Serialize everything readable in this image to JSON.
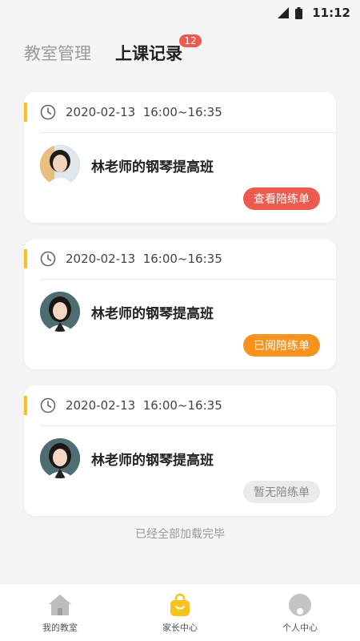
{
  "status_bar": {
    "time": "11:12"
  },
  "tabs": [
    {
      "label": "教室管理",
      "active": false
    },
    {
      "label": "上课记录",
      "active": true,
      "badge": "12"
    }
  ],
  "cards": [
    {
      "time": "2020-02-13  16:00~16:35",
      "title": "林老师的钢琴提高班",
      "action": "查看陪练单",
      "action_style": "red"
    },
    {
      "time": "2020-02-13  16:00~16:35",
      "title": "林老师的钢琴提高班",
      "action": "已阅陪练单",
      "action_style": "orange"
    },
    {
      "time": "2020-02-13  16:00~16:35",
      "title": "林老师的钢琴提高班",
      "action": "暂无陪练单",
      "action_style": "gray"
    }
  ],
  "footer_text": "已经全部加载完毕",
  "bottom_nav": [
    {
      "label": "我的教室",
      "icon": "home-icon"
    },
    {
      "label": "家长中心",
      "icon": "bag-icon",
      "active": true
    },
    {
      "label": "个人中心",
      "icon": "person-icon"
    }
  ],
  "colors": {
    "accent": "#f7c21c",
    "red": "#ec5b4d",
    "orange": "#f8921f"
  }
}
